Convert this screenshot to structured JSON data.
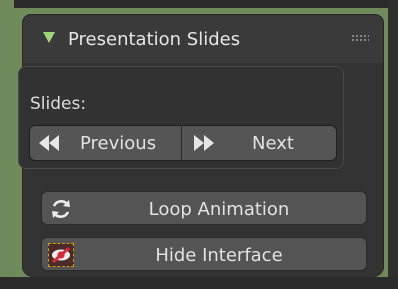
{
  "panel": {
    "title": "Presentation Slides"
  },
  "slides": {
    "label": "Slides:",
    "previous_label": "Previous",
    "next_label": "Next"
  },
  "buttons": {
    "loop_label": "Loop Animation",
    "hide_label": "Hide Interface"
  },
  "icons": {
    "collapse": "triangle-down-icon",
    "drag": "drag-handle-icon",
    "previous": "rewind-icon",
    "next": "fast-forward-icon",
    "loop": "refresh-icon",
    "hide": "hide-eye-icon"
  },
  "colors": {
    "accent_green": "#9fd57a",
    "panel_bg": "#3a3a3a",
    "button_bg": "#555555",
    "hide_icon_red": "#e0303a",
    "highlight_dash": "#d0a000"
  }
}
